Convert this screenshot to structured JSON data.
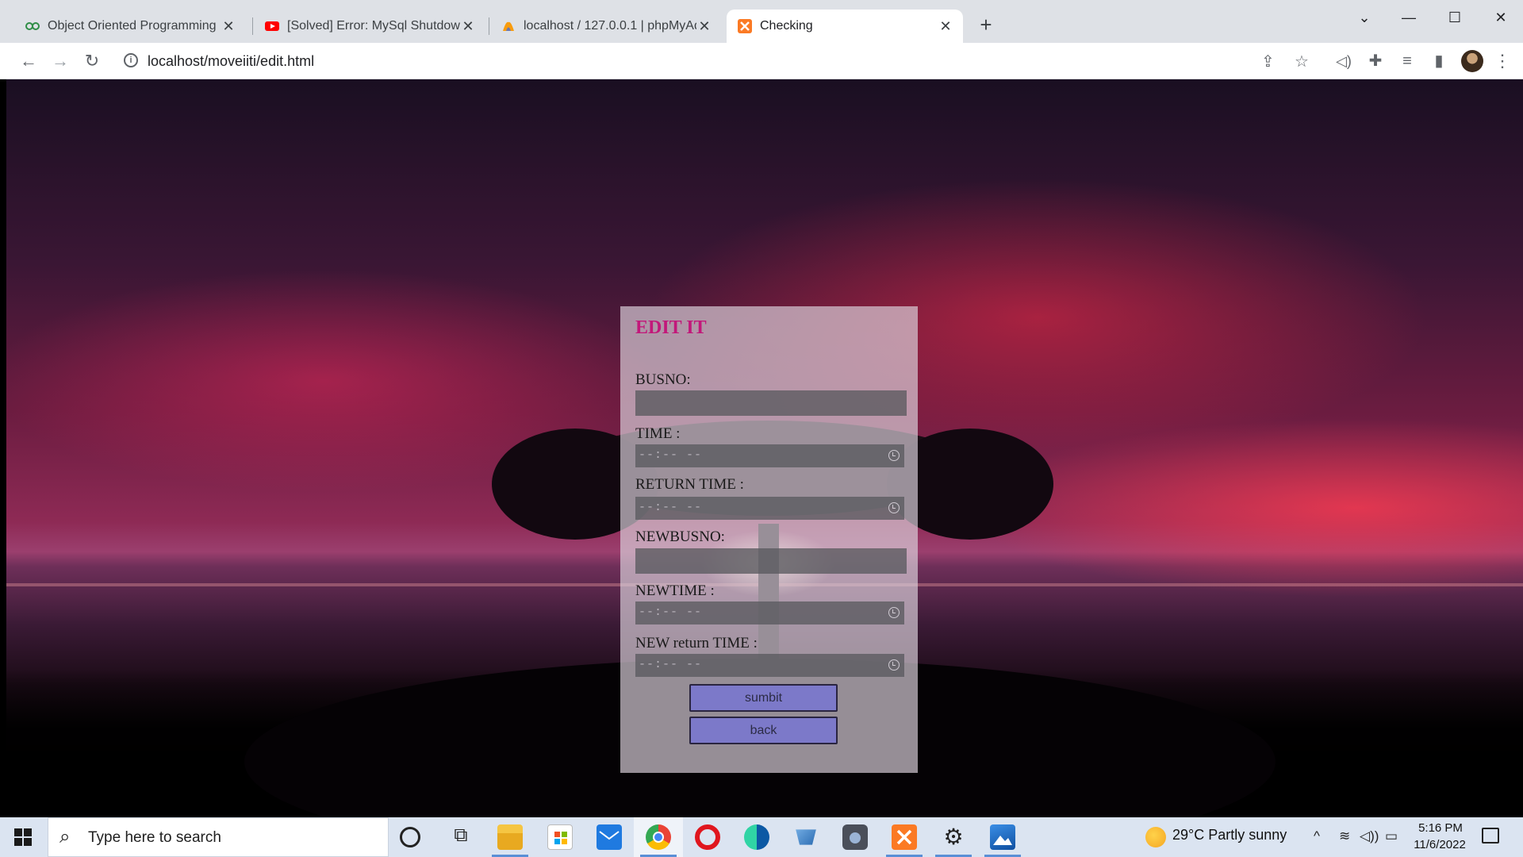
{
  "browser": {
    "tabs": [
      {
        "title": "Object Oriented Programming in",
        "icon": "geeksforgeeks-icon"
      },
      {
        "title": "[Solved] Error: MySql Shutdown U",
        "icon": "youtube-icon"
      },
      {
        "title": "localhost / 127.0.0.1 | phpMyAdm",
        "icon": "phpmyadmin-icon"
      },
      {
        "title": "Checking",
        "icon": "xampp-icon",
        "active": true
      }
    ],
    "url": "localhost/moveiiti/edit.html"
  },
  "form": {
    "title": "EDIT IT",
    "fields": [
      {
        "label": "BUSNO:",
        "type": "text",
        "value": ""
      },
      {
        "label": "TIME :",
        "type": "time",
        "placeholder": "--:-- --"
      },
      {
        "label": "RETURN TIME :",
        "type": "time",
        "placeholder": "--:-- --"
      },
      {
        "label": "NEWBUSNO:",
        "type": "text",
        "value": ""
      },
      {
        "label": "NEWTIME :",
        "type": "time",
        "placeholder": "--:-- --"
      },
      {
        "label": "NEW return TIME :",
        "type": "time",
        "placeholder": "--:-- --"
      }
    ],
    "submit_label": "sumbit",
    "back_label": "back"
  },
  "taskbar": {
    "search_placeholder": "Type here to search",
    "weather": "29°C  Partly sunny",
    "time": "5:16 PM",
    "date": "11/6/2022"
  }
}
